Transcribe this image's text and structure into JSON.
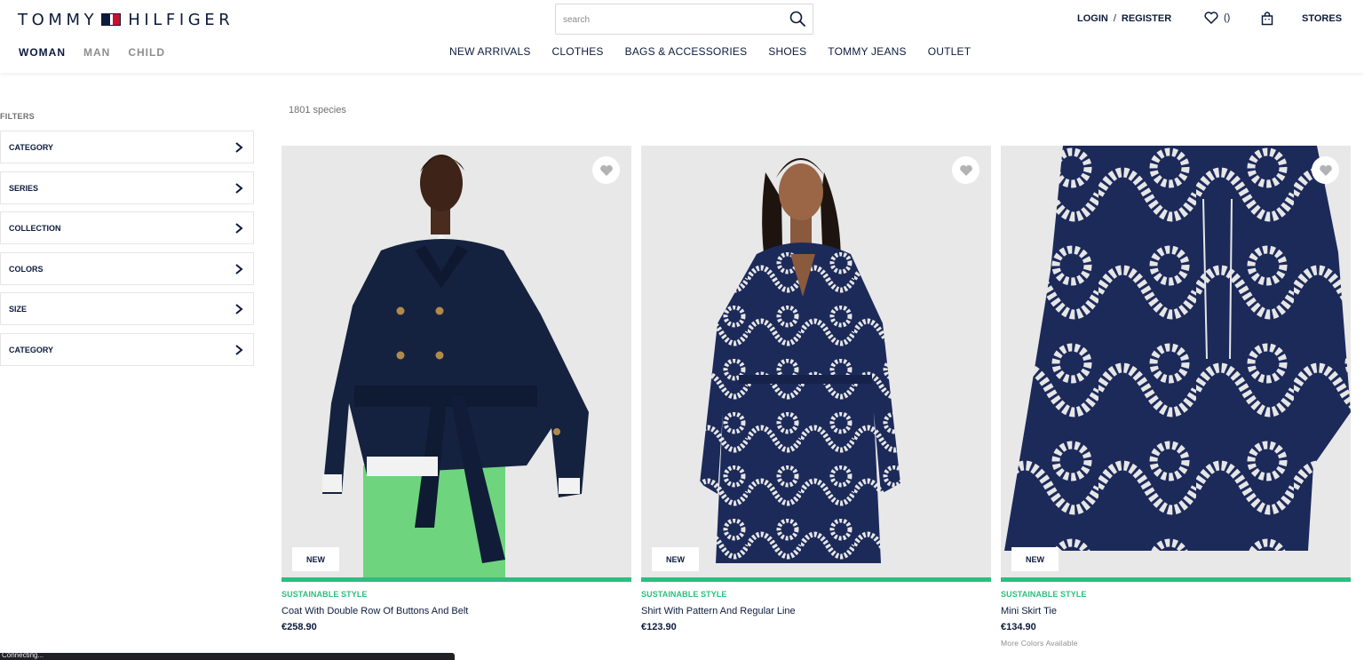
{
  "header": {
    "logo_left": "TOMMY",
    "logo_right": "HILFIGER",
    "gender_tabs": [
      "WOMAN",
      "MAN",
      "CHILD"
    ],
    "search": {
      "placeholder": "search",
      "value": ""
    },
    "nav": [
      "NEW ARRIVALS",
      "CLOTHES",
      "BAGS & ACCESSORIES",
      "SHOES",
      "TOMMY JEANS",
      "OUTLET"
    ],
    "login": "LOGIN",
    "separator": "/",
    "register": "REGISTER",
    "wishlist_count": "()",
    "stores": "STORES"
  },
  "filters": {
    "title": "FILTERS",
    "items": [
      "CATEGORY",
      "SERIES",
      "COLLECTION",
      "COLORS",
      "SIZE",
      "CATEGORY"
    ]
  },
  "listing": {
    "count": "1801 species",
    "products": [
      {
        "badge": "NEW",
        "tag": "SUSTAINABLE STYLE",
        "name": "Coat With Double Row Of Buttons And Belt",
        "price": "€258.90",
        "more": ""
      },
      {
        "badge": "NEW",
        "tag": "SUSTAINABLE STYLE",
        "name": "Shirt With Pattern And Regular Line",
        "price": "€123.90",
        "more": ""
      },
      {
        "badge": "NEW",
        "tag": "SUSTAINABLE STYLE",
        "name": "Mini Skirt Tie",
        "price": "€134.90",
        "more": "More Colors Available"
      }
    ]
  },
  "status_bar": "Connecting...",
  "colors": {
    "brand_navy": "#0c1b3c",
    "brand_red": "#c8102e",
    "sustainable_green": "#2ebd80"
  }
}
